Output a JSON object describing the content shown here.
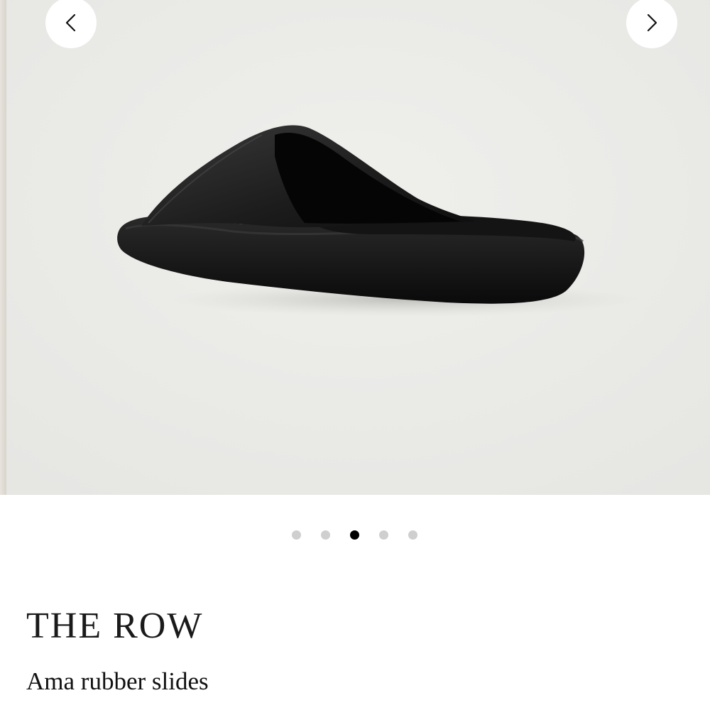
{
  "gallery": {
    "image_alt": "Ama rubber slides",
    "prev_icon": "chevron-left-icon",
    "next_icon": "chevron-right-icon",
    "slide_count": 5,
    "active_slide": 3
  },
  "product": {
    "brand": "THE ROW",
    "name": "Ama rubber slides"
  },
  "colors": {
    "background": "#ebebe8",
    "product": "#111111",
    "dot_inactive": "#cfcfcf",
    "dot_active": "#000000"
  }
}
